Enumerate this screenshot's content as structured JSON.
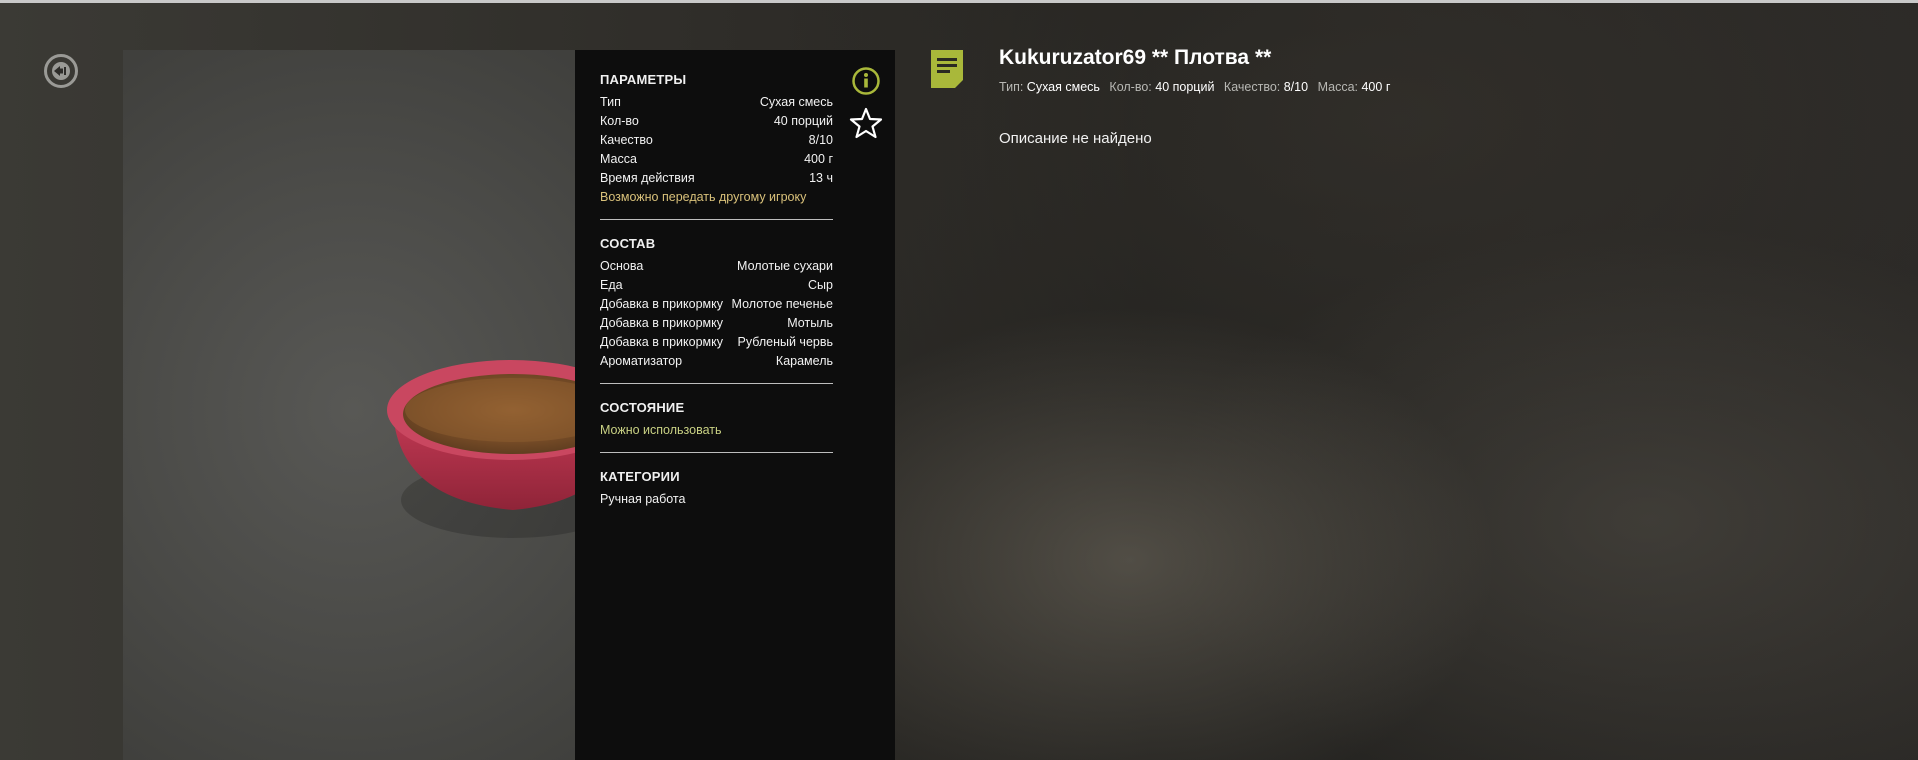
{
  "item": {
    "title": "Kukuruzator69 ** Плотва **",
    "meta": [
      {
        "label": "Тип:",
        "value": "Сухая смесь"
      },
      {
        "label": "Кол-во:",
        "value": "40 порций"
      },
      {
        "label": "Качество:",
        "value": "8/10"
      },
      {
        "label": "Масса:",
        "value": "400 г"
      }
    ],
    "description": "Описание не найдено"
  },
  "panel": {
    "params": {
      "title": "ПАРАМЕТРЫ",
      "rows": [
        {
          "k": "Тип",
          "v": "Сухая смесь"
        },
        {
          "k": "Кол-во",
          "v": "40 порций"
        },
        {
          "k": "Качество",
          "v": "8/10"
        },
        {
          "k": "Масса",
          "v": "400 г"
        },
        {
          "k": "Время действия",
          "v": "13 ч"
        }
      ],
      "note": "Возможно передать другому игроку"
    },
    "composition": {
      "title": "СОСТАВ",
      "rows": [
        {
          "k": "Основа",
          "v": "Молотые сухари"
        },
        {
          "k": "Еда",
          "v": "Сыр"
        },
        {
          "k": "Добавка в прикормку",
          "v": "Молотое печенье"
        },
        {
          "k": "Добавка в прикормку",
          "v": "Мотыль"
        },
        {
          "k": "Добавка в прикормку",
          "v": "Рубленый червь"
        },
        {
          "k": "Ароматизатор",
          "v": "Карамель"
        }
      ]
    },
    "state": {
      "title": "СОСТОЯНИЕ",
      "value": "Можно использовать"
    },
    "categories": {
      "title": "КАТЕГОРИИ",
      "value": "Ручная работа"
    }
  },
  "icons": {
    "back": "back-arrow-icon",
    "info": "info-icon",
    "favorite": "star-icon",
    "document": "document-icon"
  },
  "colors": {
    "accent": "#a9b83a",
    "note_yellow": "#d9c17a",
    "note_green": "#c9d184",
    "panel_bg": "#0d0d0d",
    "bowl": "#b8324a"
  }
}
